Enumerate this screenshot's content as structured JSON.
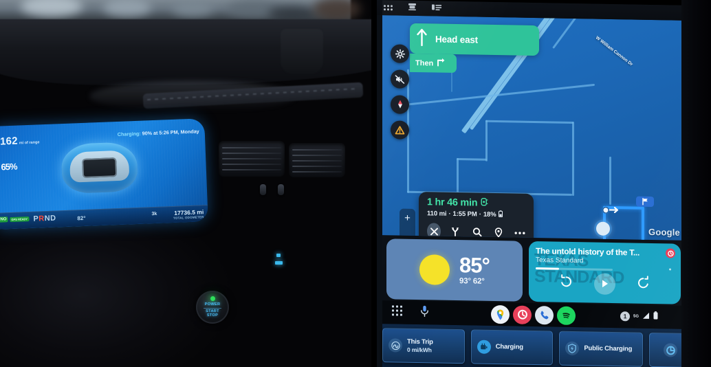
{
  "cluster": {
    "range_value": "162",
    "range_unit": "mi of range",
    "soc_value": "65",
    "soc_unit": "%",
    "charge_status_label": "Charging:",
    "charge_status_detail": "90% at 5:26 PM, Monday",
    "gear_prefix": "P",
    "gear_active": "R",
    "gear_suffix": "ND",
    "exterior_temp": "82°",
    "odometer_value": "17736.5 mi",
    "odometer_label": "TOTAL ODOMETER",
    "left_badge_top": "NO",
    "left_badge_bottom": "GPS READY",
    "mid_indicator": "3k"
  },
  "console": {
    "start_button_line1": "POWER",
    "start_button_line2": "START",
    "start_button_line3": "STOP"
  },
  "status_bar": {
    "icons": [
      {
        "name": "app-grid-icon"
      },
      {
        "name": "seat-icon"
      },
      {
        "name": "list-panel-icon"
      }
    ]
  },
  "navigation": {
    "maneuver_text": "Head east",
    "maneuver_icon": "arrow-up-icon",
    "then_label": "Then",
    "then_icon": "turn-right-icon",
    "rail": [
      {
        "name": "settings-gear-icon",
        "label": "Settings"
      },
      {
        "name": "mute-speaker-icon",
        "label": "Mute voice"
      },
      {
        "name": "compass-icon",
        "label": "Compass"
      },
      {
        "name": "report-warning-icon",
        "label": "Report incident"
      }
    ],
    "zoom_in": "+",
    "zoom_out": "−",
    "road_label": "W William Cannon Dr",
    "map_attribution": "Google"
  },
  "trip": {
    "eta_duration": "1 hr 46 min",
    "traffic_icon": "traffic-light-icon",
    "distance": "110 mi",
    "arrival_time": "1:55 PM",
    "battery_at_arrival": "18%",
    "battery_icon": "battery-icon",
    "separator": "·",
    "actions": [
      {
        "name": "close-route-icon",
        "label": "Exit navigation"
      },
      {
        "name": "alternate-routes-icon",
        "label": "Routes"
      },
      {
        "name": "search-icon",
        "label": "Search along route"
      },
      {
        "name": "place-pin-icon",
        "label": "Destination"
      },
      {
        "name": "more-options-icon",
        "label": "More"
      }
    ]
  },
  "weather": {
    "icon": "sun-icon",
    "temperature": "85°",
    "high": "93°",
    "low": "62°"
  },
  "media": {
    "title": "The untold history of the T...",
    "artist": "Texas Standard",
    "artwork_text": "TEXAS STANDARD",
    "rewind_icon": "replay-back-icon",
    "play_icon": "play-icon",
    "forward_icon": "replay-forward-icon",
    "badge_icon": "pocketcasts-icon"
  },
  "taskbar": {
    "left": [
      {
        "name": "app-launcher-icon",
        "label": "Apps"
      },
      {
        "name": "microphone-icon",
        "label": "Assistant"
      }
    ],
    "apps": [
      {
        "name": "google-maps-icon",
        "label": "Maps"
      },
      {
        "name": "pocket-casts-icon",
        "label": "Pocket Casts"
      },
      {
        "name": "phone-icon",
        "label": "Phone"
      },
      {
        "name": "spotify-icon",
        "label": "Spotify"
      }
    ],
    "notification_count": "1",
    "signal_label": "5G",
    "signal_icon": "signal-bars-icon",
    "battery_icon": "battery-icon"
  },
  "vehicle_cards": [
    {
      "icon": "efficiency-icon",
      "title": "This Trip",
      "subtitle": "0 mi/kWh"
    },
    {
      "icon": "charging-plug-icon",
      "title": "Charging",
      "subtitle": ""
    },
    {
      "icon": "public-charging-icon",
      "title": "Public Charging",
      "subtitle": ""
    },
    {
      "icon": "settings-circle-icon",
      "title": "",
      "subtitle": ""
    }
  ],
  "colors": {
    "nav_green": "#2fc39a",
    "eta_green": "#43e3a8",
    "map_blue": "#1d6ab9",
    "route_blue": "#2e9bff",
    "weather_card": "#5e85b5",
    "media_card": "#1aa5c4",
    "sun_yellow": "#f5e229",
    "cluster_blue": "#1277d6"
  }
}
